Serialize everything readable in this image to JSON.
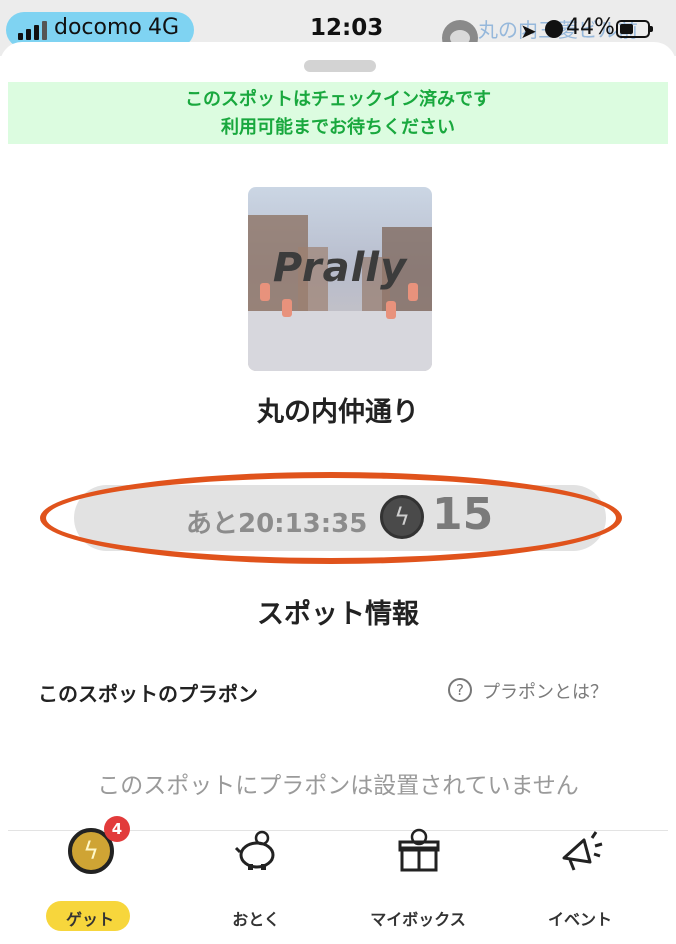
{
  "status_bar": {
    "carrier": "docomo",
    "network": "4G",
    "time": "12:03",
    "background_title": "丸の内三菱ビル前",
    "battery_percent": "44%"
  },
  "notice": {
    "line1": "このスポットはチェックイン済みです",
    "line2": "利用可能までお待ちください"
  },
  "spot": {
    "image_brand": "Prally",
    "name": "丸の内仲通り"
  },
  "timer": {
    "remaining": "あと20:13:35",
    "points": "15"
  },
  "spot_info": {
    "title": "スポット情報",
    "plapon_label": "このスポットのプラポン",
    "help_icon": "?",
    "help_link": "プラポンとは？",
    "empty_message": "このスポットにプラポンは設置されていません"
  },
  "bottom_nav": {
    "items": [
      {
        "label": "ゲット",
        "icon": "lightning-coin-icon",
        "badge": "4",
        "active": true
      },
      {
        "label": "おとく",
        "icon": "piggy-bank-icon"
      },
      {
        "label": "マイボックス",
        "icon": "gift-box-icon"
      },
      {
        "label": "イベント",
        "icon": "megaphone-icon"
      }
    ]
  },
  "colors": {
    "notice_bg": "#dcfce0",
    "notice_text": "#19a83e",
    "highlight_ring": "#e0531c",
    "active_tab": "#f7d63c",
    "badge": "#e23b3b"
  }
}
